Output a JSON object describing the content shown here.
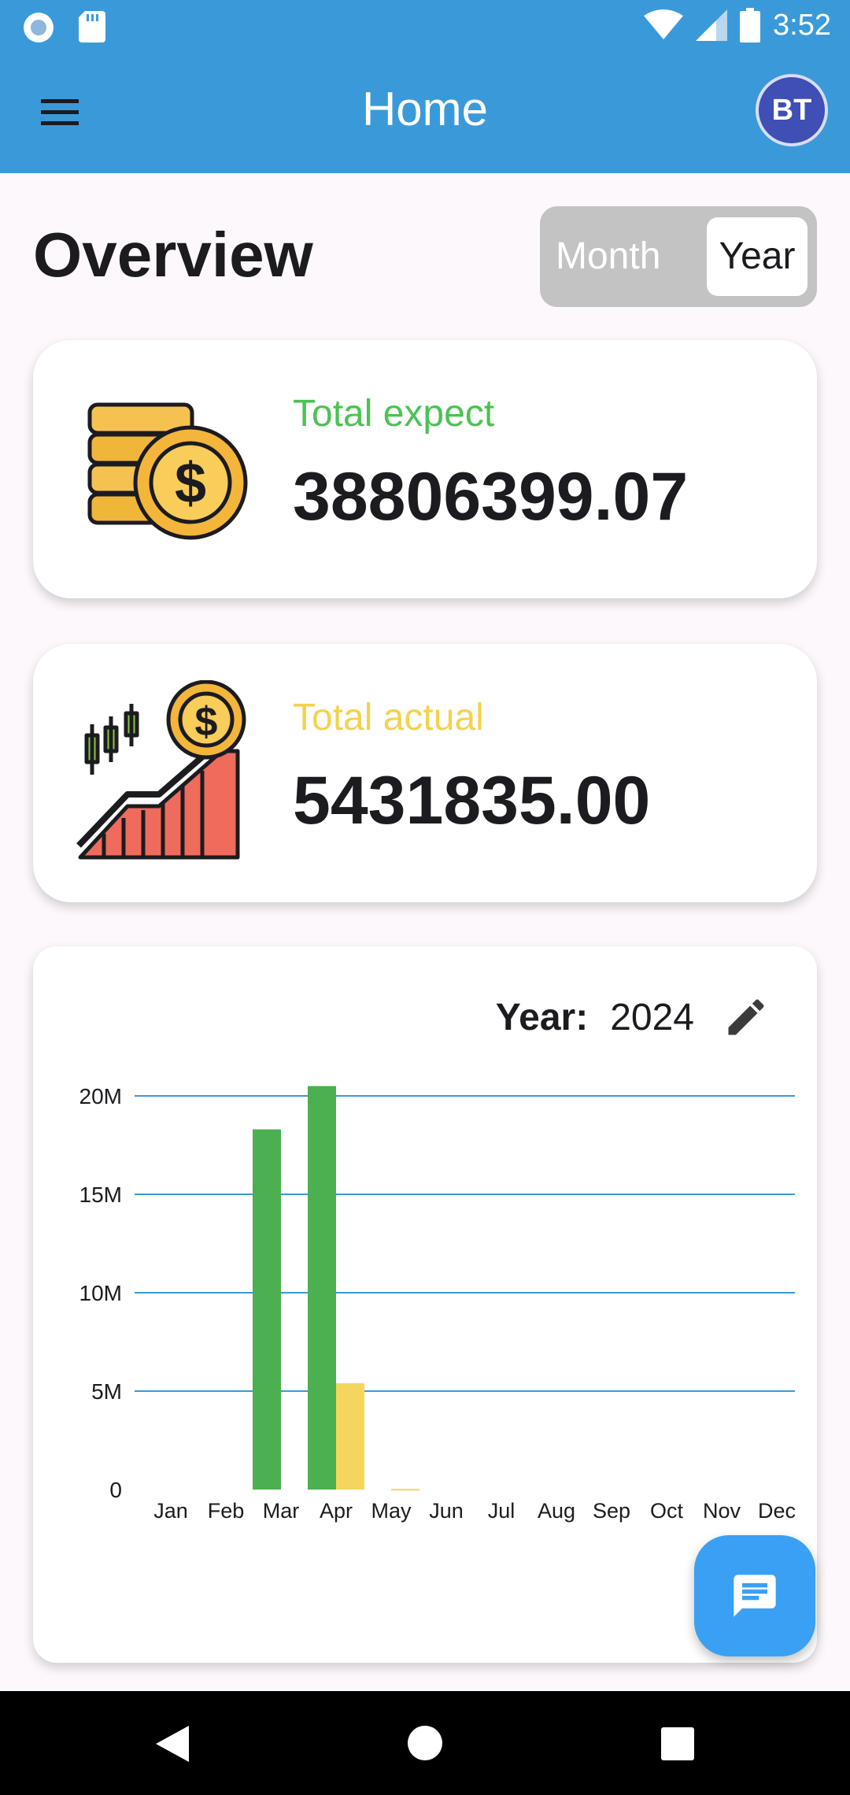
{
  "status_bar": {
    "time": "3:52",
    "icons": [
      "circle-notification-icon",
      "sd-card-icon",
      "wifi-icon",
      "cell-signal-icon",
      "battery-icon"
    ]
  },
  "app_bar": {
    "title": "Home",
    "avatar_initials": "BT",
    "menu_icon": "hamburger-menu-icon"
  },
  "overview": {
    "title": "Overview",
    "toggle": {
      "options": [
        "Month",
        "Year"
      ],
      "selected": "Year"
    }
  },
  "cards": {
    "expect": {
      "label": "Total expect",
      "value": "38806399.07",
      "label_color": "#4cc253",
      "icon": "coins-dollar-icon"
    },
    "actual": {
      "label": "Total actual",
      "value": "5431835.00",
      "label_color": "#f3d24f",
      "icon": "growth-chart-dollar-icon"
    }
  },
  "chart_panel": {
    "year_label": "Year:",
    "year_value": "2024",
    "edit_icon": "pencil-icon"
  },
  "chart_data": {
    "type": "bar",
    "categories": [
      "Jan",
      "Feb",
      "Mar",
      "Apr",
      "May",
      "Jun",
      "Jul",
      "Aug",
      "Sep",
      "Oct",
      "Nov",
      "Dec"
    ],
    "series": [
      {
        "color": "#4caf50",
        "values": [
          0,
          0,
          18300000,
          20500000,
          0,
          0,
          0,
          0,
          0,
          0,
          0,
          0
        ]
      },
      {
        "color": "#f6d55c",
        "values": [
          0,
          0,
          0,
          5400000,
          30000,
          0,
          0,
          0,
          0,
          0,
          0,
          0
        ]
      }
    ],
    "ylim": [
      0,
      20000000
    ],
    "yticks": [
      0,
      5000000,
      10000000,
      15000000,
      20000000
    ],
    "ytick_labels": [
      "0",
      "5M",
      "10M",
      "15M",
      "20M"
    ],
    "grid": true,
    "grid_color": "#3a9ad9"
  },
  "fab": {
    "icon": "chat-message-icon"
  },
  "nav_bar": {
    "icons": [
      "back-triangle-icon",
      "home-circle-icon",
      "recents-square-icon"
    ]
  }
}
